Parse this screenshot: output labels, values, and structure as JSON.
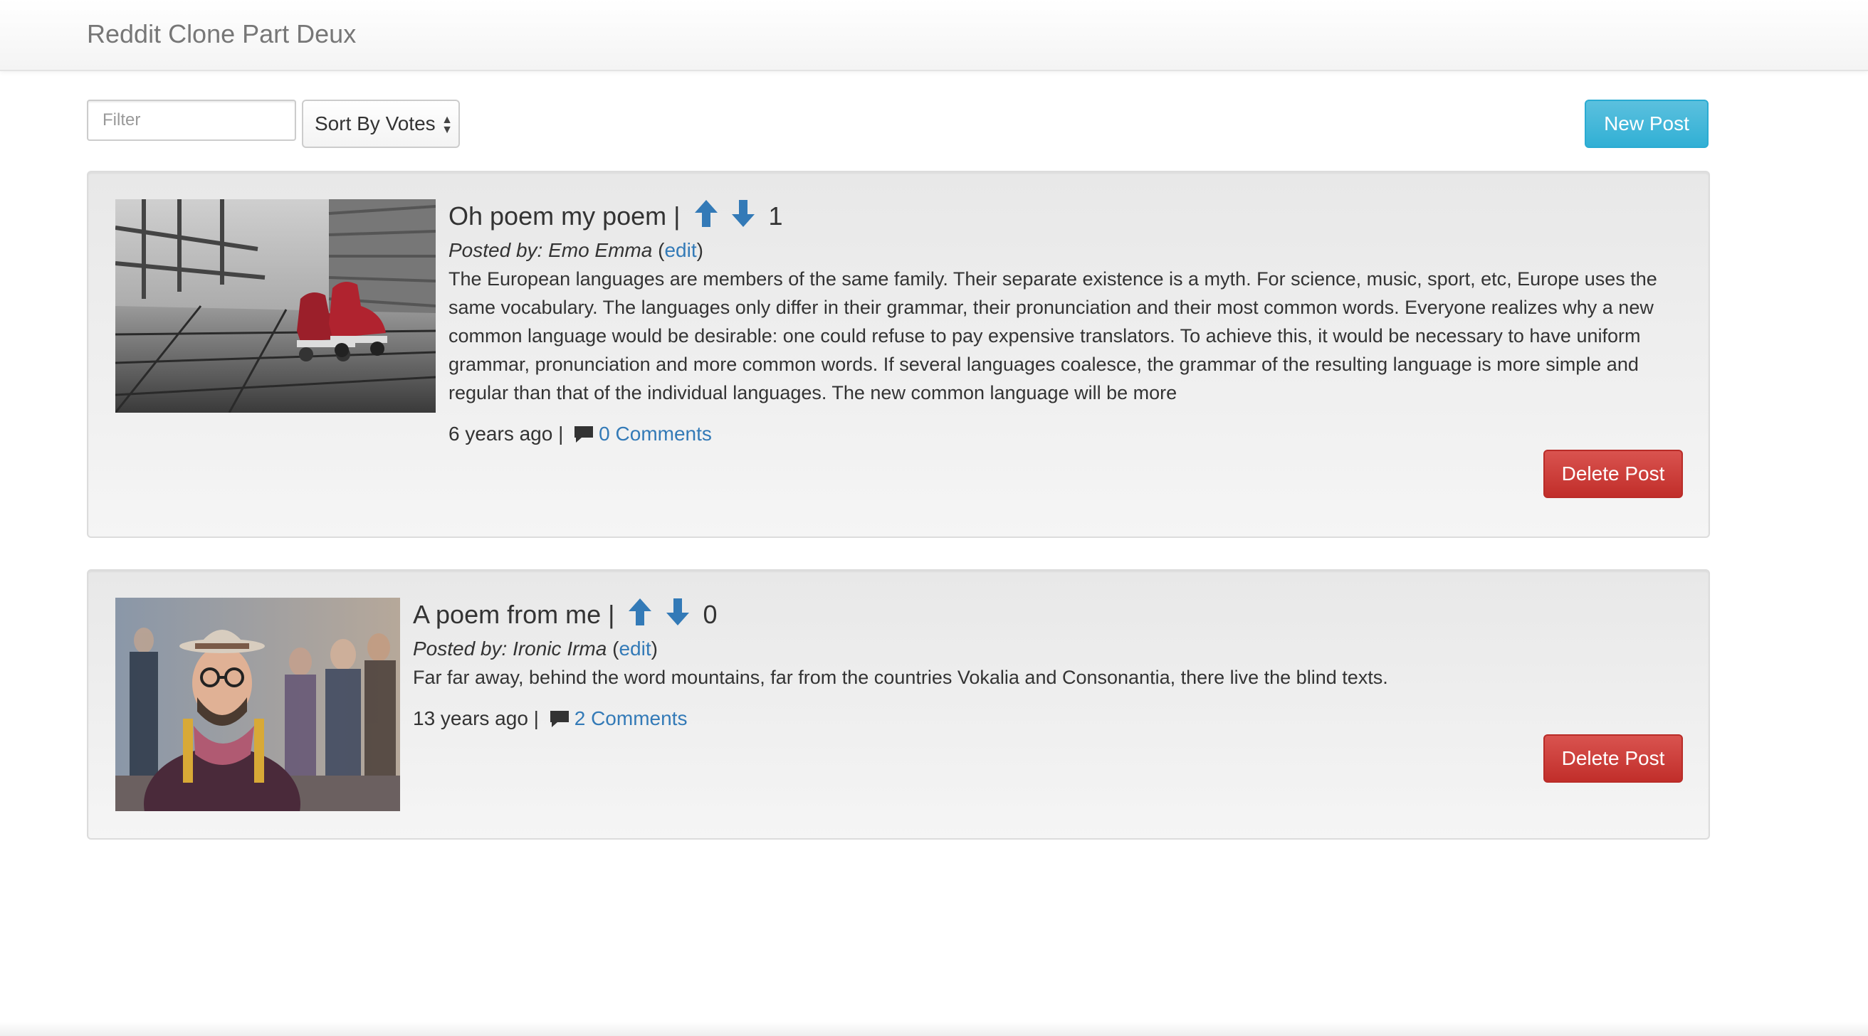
{
  "navbar": {
    "brand": "Reddit Clone Part Deux"
  },
  "toolbar": {
    "filter_placeholder": "Filter",
    "sort_selected": "Sort By Votes",
    "new_post_label": "New Post"
  },
  "colors": {
    "link": "#337ab7",
    "vote_arrow": "#337ab7",
    "info_button": "#5bc0de",
    "danger_button": "#d9534f"
  },
  "posts": [
    {
      "title": "Oh poem my poem",
      "separator": "|",
      "score": "1",
      "posted_by_prefix": "Posted by: Emo Emma",
      "edit_label": "edit",
      "body": "The European languages are members of the same family. Their separate existence is a myth. For science, music, sport, etc, Europe uses the same vocabulary. The languages only differ in their grammar, their pronunciation and their most common words. Everyone realizes why a new common language would be desirable: one could refuse to pay expensive translators. To achieve this, it would be necessary to have uniform grammar, pronunciation and more common words. If several languages coalesce, the grammar of the resulting language is more simple and regular than that of the individual languages. The new common language will be more",
      "age": "6 years ago",
      "comments_label": "0 Comments",
      "delete_label": "Delete Post",
      "image_subject": "red roller skates on wooden deck"
    },
    {
      "title": "A poem from me",
      "separator": "|",
      "score": "0",
      "posted_by_prefix": "Posted by: Ironic Irma",
      "edit_label": "edit",
      "body": "Far far away, behind the word mountains, far from the countries Vokalia and Consonantia, there live the blind texts.",
      "age": "13 years ago",
      "comments_label": "2 Comments",
      "delete_label": "Delete Post",
      "image_subject": "man with hat, glasses and scarf in a crowd"
    }
  ]
}
